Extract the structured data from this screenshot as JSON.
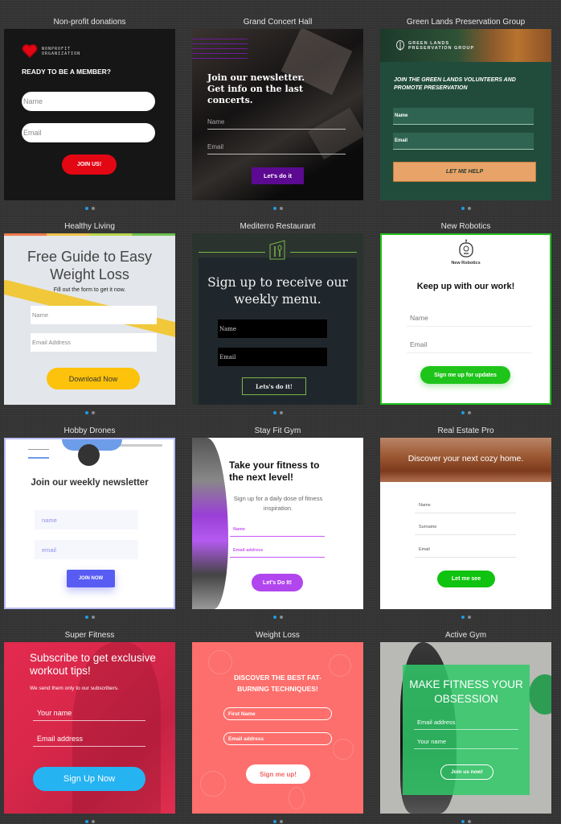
{
  "templates": [
    {
      "title": "Non-profit donations",
      "logo_line1": "NONPROFIT",
      "logo_line2": "ORGANIZATION",
      "heading": "READY TO BE A MEMBER?",
      "fields": [
        "Name",
        "Email"
      ],
      "button": "JOIN US!",
      "accent": "#e30613",
      "slides": 2,
      "active_slide": 1
    },
    {
      "title": "Grand Concert Hall",
      "heading": "Join our newsletter. Get info on the last concerts.",
      "fields": [
        "Name",
        "Email"
      ],
      "button": "Let's do it",
      "accent": "#5c0a91",
      "slides": 2,
      "active_slide": 1
    },
    {
      "title": "Green Lands Preservation Group",
      "banner_line1": "GREEN LANDS",
      "banner_line2": "PRESERVATION GROUP",
      "heading": "JOIN THE GREEN LANDS VOLUNTEERS AND PROMOTE PRESERVATION",
      "fields": [
        "Name",
        "Email"
      ],
      "button": "LET ME HELP",
      "accent": "#e8a468",
      "slides": 2,
      "active_slide": 1
    },
    {
      "title": "Healthy Living",
      "heading": "Free Guide to Easy Weight Loss",
      "subheading": "Fill out the form to get it now.",
      "fields": [
        "Name",
        "Email Address"
      ],
      "button": "Download Now",
      "accent": "#fdc20b",
      "slides": 2,
      "active_slide": 1
    },
    {
      "title": "Mediterro Restaurant",
      "heading": "Sign up to receive our weekly menu.",
      "fields": [
        "Name",
        "Email"
      ],
      "button": "Lets's do it!",
      "accent": "#7ab648",
      "slides": 2,
      "active_slide": 1
    },
    {
      "title": "New Robotics",
      "brand": "New Robotics",
      "heading": "Keep up with our work!",
      "fields": [
        "Name",
        "Email"
      ],
      "button": "Sign me up for updates",
      "accent": "#1fc41b",
      "slides": 2,
      "active_slide": 1
    },
    {
      "title": "Hobby Drones",
      "heading": "Join our weekly newsletter",
      "fields": [
        "name",
        "email"
      ],
      "button": "JOIN NOW",
      "accent": "#585cf2",
      "slides": 2,
      "active_slide": 1
    },
    {
      "title": "Stay Fit Gym",
      "heading": "Take your fitness to the next level!",
      "subheading": "Sign up for a daily dose of fitness inspiration.",
      "fields": [
        "Name",
        "Email address"
      ],
      "button": "Let's Do It!",
      "accent": "#b146ef",
      "slides": 2,
      "active_slide": 1
    },
    {
      "title": "Real Estate Pro",
      "heading": "Discover your next cozy home.",
      "fields": [
        "Name",
        "Surname",
        "Email"
      ],
      "button": "Let me see",
      "accent": "#11c311",
      "slides": 2,
      "active_slide": 1
    },
    {
      "title": "Super Fitness",
      "heading": "Subscribe to get exclusive workout tips!",
      "subheading": "We send them only to our subscribers.",
      "fields": [
        "Your name",
        "Email address"
      ],
      "button": "Sign Up Now",
      "accent": "#26b3f2",
      "slides": 2,
      "active_slide": 1
    },
    {
      "title": "Weight Loss",
      "heading": "DISCOVER THE BEST FAT-BURNING TECHNIQUES!",
      "fields": [
        "First Name",
        "Email address"
      ],
      "button": "Sign me up!",
      "accent": "#fd6f6c",
      "slides": 2,
      "active_slide": 1
    },
    {
      "title": "Active Gym",
      "heading": "MAKE FITNESS YOUR OBSESSION",
      "fields": [
        "Email address",
        "Your name"
      ],
      "button": "Join us now!",
      "accent": "#30c969",
      "slides": 2,
      "active_slide": 1
    }
  ]
}
